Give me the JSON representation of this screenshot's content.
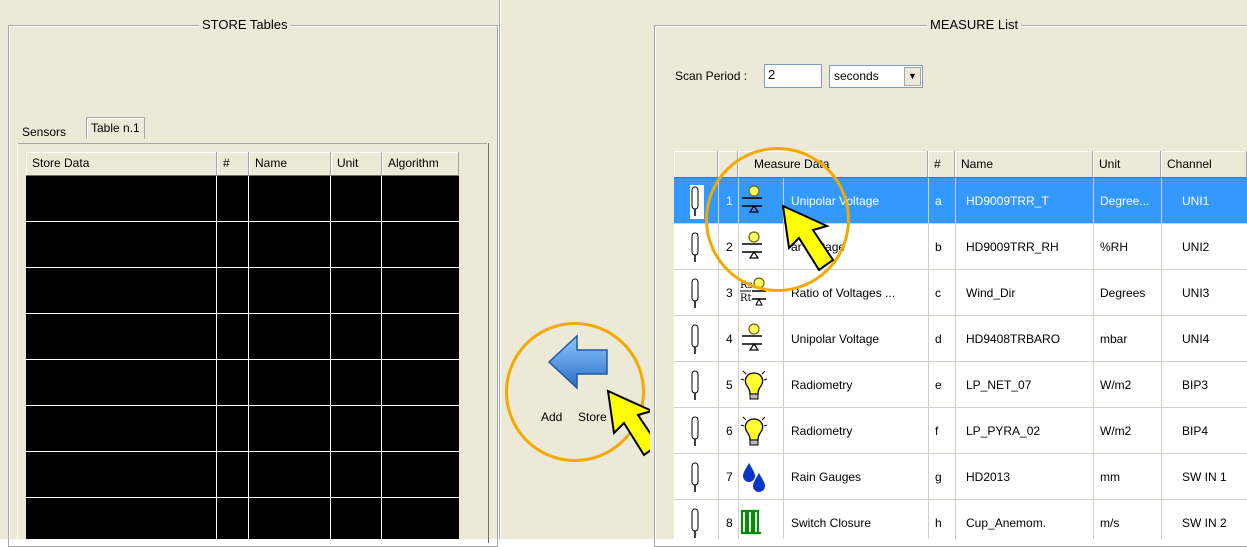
{
  "store_panel": {
    "title": "STORE Tables",
    "tabs": [
      "Sensors",
      "Table n.1"
    ],
    "active_tab": "Table n.1",
    "columns": [
      "Store Data",
      "#",
      "Name",
      "Unit",
      "Algorithm"
    ]
  },
  "add_store": {
    "label_add": "Add",
    "label_store": "Store"
  },
  "measure_panel": {
    "title": "MEASURE List",
    "scan_period_label": "Scan Period :",
    "scan_period_value": "2",
    "scan_unit": "seconds",
    "columns": [
      "Measure Data",
      "#",
      "Name",
      "Unit",
      "Channel"
    ],
    "rows": [
      {
        "index": "1",
        "measure": "Unipolar Voltage",
        "hash": "a",
        "name": "HD9009TRR_T",
        "unit": "Degree...",
        "channel": "UNI1",
        "icon": "unipolar-voltage-icon",
        "selected": true
      },
      {
        "index": "2",
        "measure": "ar Voltage",
        "hash": "b",
        "name": "HD9009TRR_RH",
        "unit": "%RH",
        "channel": "UNI2",
        "icon": "unipolar-voltage-icon",
        "selected": false
      },
      {
        "index": "3",
        "measure": "Ratio of Voltages ...",
        "hash": "c",
        "name": "Wind_Dir",
        "unit": "Degrees",
        "channel": "UNI3",
        "icon": "ratio-voltage-icon",
        "selected": false
      },
      {
        "index": "4",
        "measure": "Unipolar Voltage",
        "hash": "d",
        "name": "HD9408TRBARO",
        "unit": "mbar",
        "channel": "UNI4",
        "icon": "unipolar-voltage-icon",
        "selected": false
      },
      {
        "index": "5",
        "measure": "Radiometry",
        "hash": "e",
        "name": "LP_NET_07",
        "unit": "W/m2",
        "channel": "BIP3",
        "icon": "lightbulb-icon",
        "selected": false
      },
      {
        "index": "6",
        "measure": "Radiometry",
        "hash": "f",
        "name": "LP_PYRA_02",
        "unit": "W/m2",
        "channel": "BIP4",
        "icon": "lightbulb-icon",
        "selected": false
      },
      {
        "index": "7",
        "measure": "Rain Gauges",
        "hash": "g",
        "name": "HD2013",
        "unit": "mm",
        "channel": "SW IN 1",
        "icon": "raindrops-icon",
        "selected": false
      },
      {
        "index": "8",
        "measure": "Switch Closure",
        "hash": "h",
        "name": "Cup_Anemom.",
        "unit": "m/s",
        "channel": "SW IN 2",
        "icon": "switch-closure-icon",
        "selected": false
      }
    ],
    "ratio_icon_label": "Rs\nRt"
  },
  "colors": {
    "selection": "#3399ff",
    "highlight_ring": "#f2a900",
    "arrow_blue": "#3f88d6",
    "pointer_yellow": "#ffff00"
  }
}
